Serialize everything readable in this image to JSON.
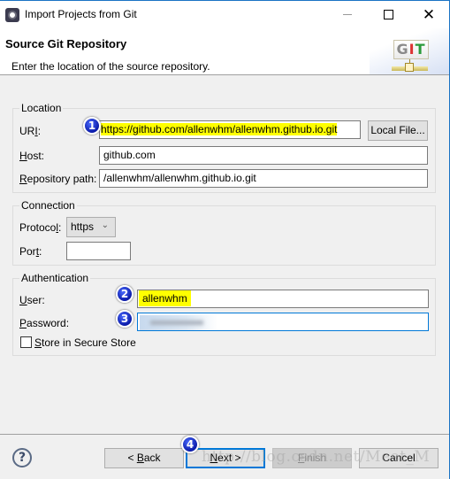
{
  "window": {
    "title": "Import Projects from Git",
    "controls": {
      "minimize": "—",
      "maximize": "☐",
      "close": "✕"
    }
  },
  "header": {
    "title": "Source Git Repository",
    "description": "Enter the location of the source repository.",
    "logo": {
      "g": "G",
      "i": "I",
      "t": "T"
    }
  },
  "location": {
    "group_title": "Location",
    "uri_label": {
      "pre": "UR",
      "mnemonic": "I",
      "post": ":"
    },
    "uri_value": "https://github.com/allenwhm/allenwhm.github.io.git",
    "local_file_button": "Local File...",
    "host_label": {
      "mnemonic": "H",
      "post": "ost:"
    },
    "host_value": "github.com",
    "repo_path_label": {
      "mnemonic": "R",
      "post": "epository path:"
    },
    "repo_path_value": "/allenwhm/allenwhm.github.io.git"
  },
  "connection": {
    "group_title": "Connection",
    "protocol_label": {
      "pre": "Protoco",
      "mnemonic": "l",
      "post": ":"
    },
    "protocol_value": "https",
    "port_label": {
      "pre": "Por",
      "mnemonic": "t",
      "post": ":"
    },
    "port_value": ""
  },
  "authentication": {
    "group_title": "Authentication",
    "user_label": {
      "mnemonic": "U",
      "post": "ser:"
    },
    "user_value": "allenwhm",
    "password_label": {
      "mnemonic": "P",
      "post": "assword:"
    },
    "store_label": {
      "mnemonic": "S",
      "post": "tore in Secure Store"
    },
    "store_checked": false
  },
  "annotations": {
    "step1": "1",
    "step2": "2",
    "step3": "3",
    "step4": "4"
  },
  "footer": {
    "help": "?",
    "back": {
      "pre": "< ",
      "mnemonic": "B",
      "post": "ack"
    },
    "next": {
      "mnemonic": "N",
      "post": "ext >"
    },
    "finish": {
      "mnemonic": "F",
      "post": "inish"
    },
    "cancel": "Cancel",
    "watermark": "http://blog.csdn.net/Meet_M"
  },
  "colors": {
    "highlight": "#ffff00",
    "badge": "#0a1aa8",
    "focus_border": "#0078d7",
    "window_border": "#1a73c4"
  }
}
